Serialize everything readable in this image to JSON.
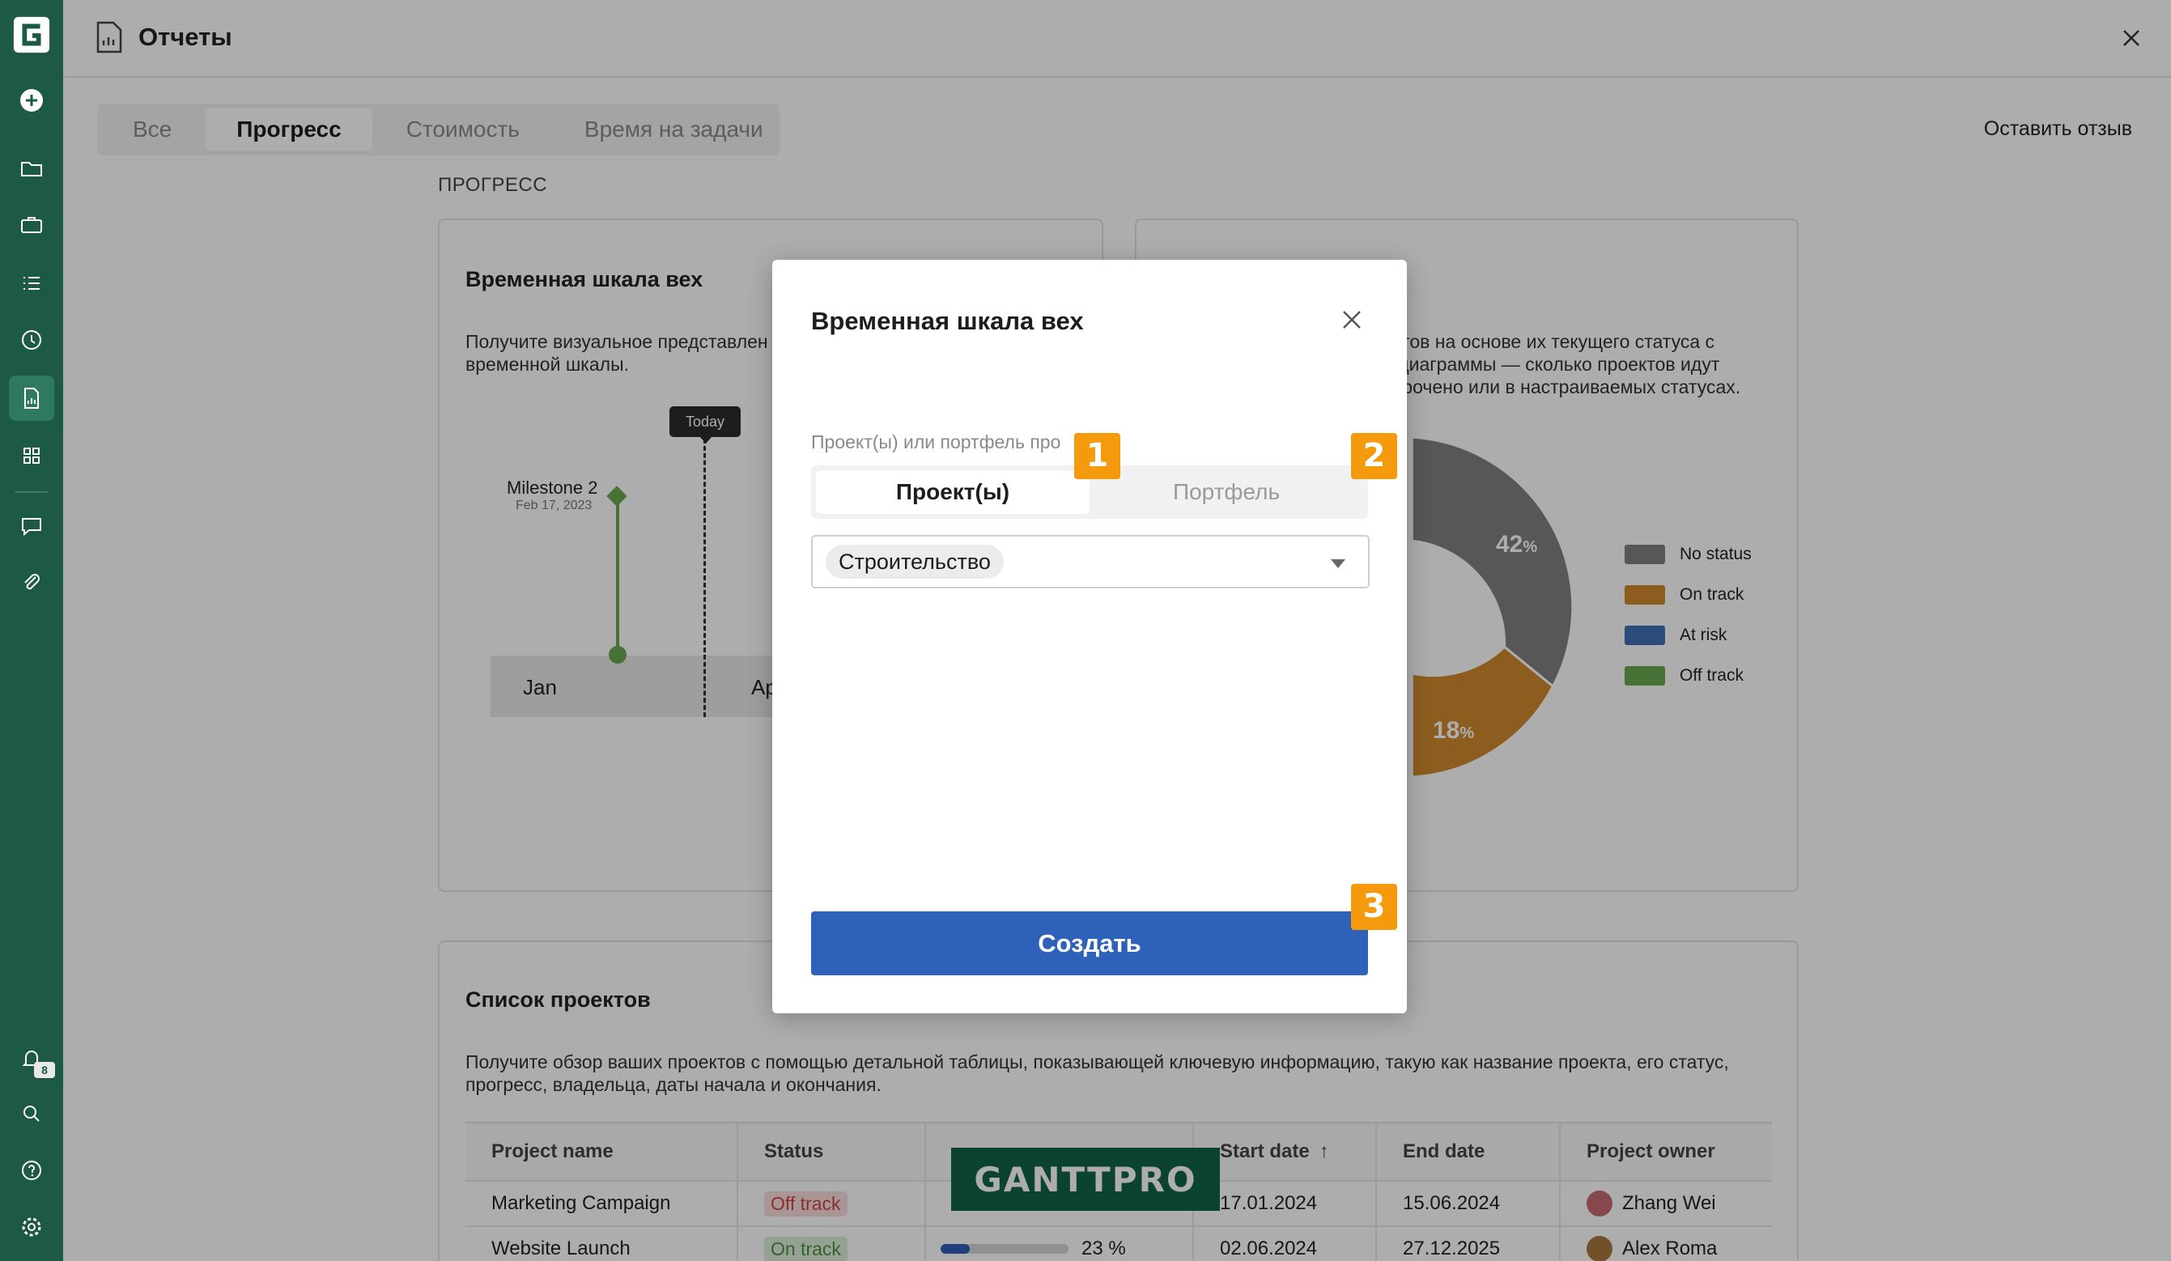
{
  "header": {
    "title": "Отчеты"
  },
  "tabs": [
    {
      "label": "Все"
    },
    {
      "label": "Прогресс",
      "active": true
    },
    {
      "label": "Стоимость"
    },
    {
      "label": "Время на задачи"
    }
  ],
  "feedback_label": "Оставить отзыв",
  "section_label": "ПРОГРЕСС",
  "milestone_card": {
    "title": "Временная шкала вех",
    "description_line1": "Получите визуальное представлен",
    "description_line2": "временной шкалы.",
    "today_label": "Today",
    "milestone_name": "Milestone 2",
    "milestone_date": "Feb 17, 2023",
    "months": [
      "Jan",
      "Ap"
    ]
  },
  "status_card": {
    "description_line1": "ектов на основе их текущего статуса с",
    "description_line2": "й диаграммы — сколько проектов идут",
    "description_line3": "осрочено или в настраиваемых статусах.",
    "slices": [
      {
        "label": "No status",
        "value": 42,
        "color": "#808080"
      },
      {
        "label": "On track",
        "value": 18,
        "color": "#d08a2e"
      },
      {
        "label": "At risk",
        "value": 0,
        "color": "#3f6fb5"
      },
      {
        "label": "Off track",
        "value": 0,
        "color": "#6aa84f"
      }
    ],
    "pct_42": "42",
    "pct_18": "18",
    "pct_sign": "%"
  },
  "projects_card": {
    "title": "Список проектов",
    "description_line1": "Получите обзор ваших проектов с помощью детальной таблицы, показывающей ключевую информацию, такую как название проекта, его статус,",
    "description_line2": "прогресс, владельца, даты начала и окончания.",
    "columns": [
      "Project name",
      "Status",
      "",
      "Start date",
      "End date",
      "Project owner"
    ],
    "sort_indicator": "↑",
    "rows": [
      {
        "name": "Marketing Campaign",
        "status": "Off track",
        "progress_text": "",
        "start": "17.01.2024",
        "end": "15.06.2024",
        "owner": "Zhang Wei"
      },
      {
        "name": "Website Launch",
        "status": "On track",
        "progress": 0.23,
        "progress_text": "23 %",
        "start": "02.06.2024",
        "end": "27.12.2025",
        "owner": "Alex Roma"
      }
    ]
  },
  "watermark": "GANTTPRO",
  "rail": {
    "notification_count": "8"
  },
  "modal": {
    "title": "Временная шкала вех",
    "field_label": "Проект(ы) или портфель про",
    "segment_projects": "Проект(ы)",
    "segment_portfolio": "Портфель",
    "selected_project": "Строительство",
    "create_label": "Создать"
  },
  "markers": [
    "1",
    "2",
    "3"
  ],
  "colors": {
    "rail": "#1d5a44",
    "primary": "#2e62ba",
    "marker": "#f59a0c"
  }
}
